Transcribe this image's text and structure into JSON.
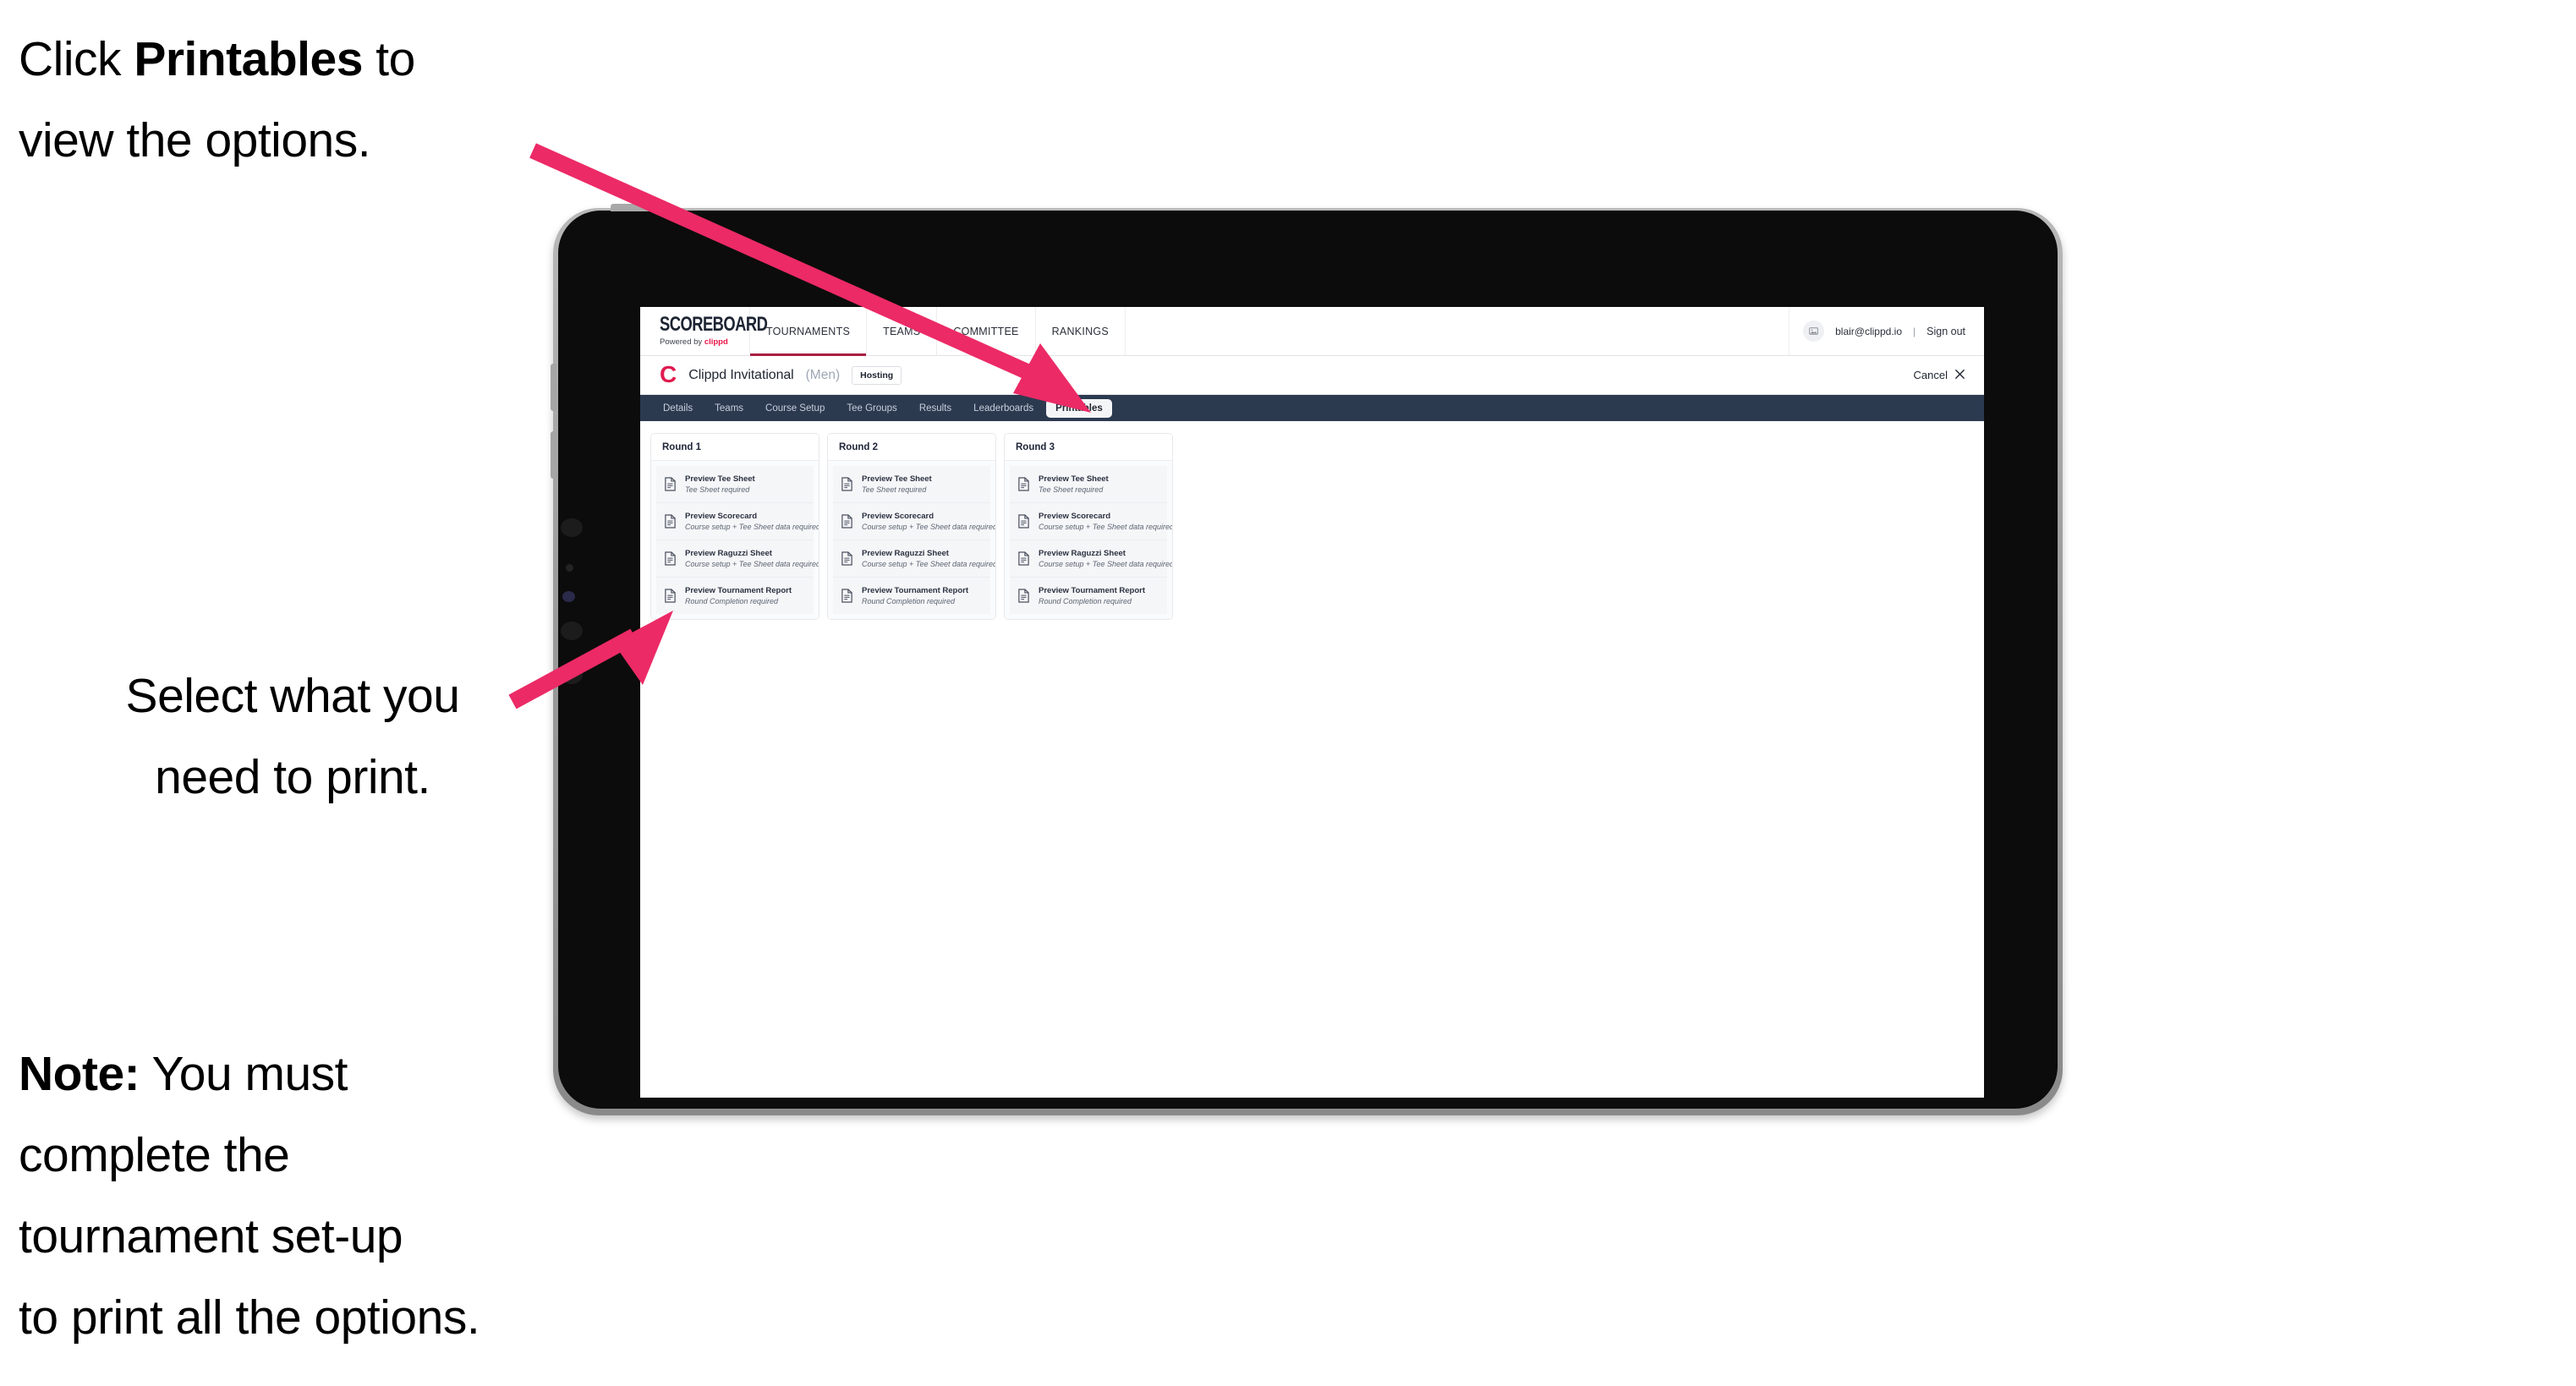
{
  "annotations": {
    "click_line1_pre": "Click ",
    "click_bold": "Printables",
    "click_line1_post": " to",
    "click_line2": "view the options.",
    "select_line1": "Select what you",
    "select_line2": "need to print.",
    "note_bold": "Note:",
    "note_line1_post": " You must",
    "note_line2": "complete the",
    "note_line3": "tournament set-up",
    "note_line4": "to print all the options."
  },
  "colors": {
    "arrow_pink": "#ec2a66",
    "tabbar_navy": "#2c3a50",
    "brand_red": "#e8174a",
    "clippd_red": "#e01a4f",
    "active_underline": "#a81f41"
  },
  "app": {
    "brand": {
      "title": "SCOREBOARD",
      "powered_prefix": "Powered by ",
      "powered_brand": "clippd"
    },
    "topnav": [
      {
        "label": "TOURNAMENTS",
        "active": true
      },
      {
        "label": "TEAMS",
        "active": false
      },
      {
        "label": "COMMITTEE",
        "active": false
      },
      {
        "label": "RANKINGS",
        "active": false
      }
    ],
    "account": {
      "avatar_icon": "user-image-icon",
      "email": "blair@clippd.io",
      "separator": "|",
      "sign_out": "Sign out"
    },
    "title_row": {
      "logo_letter": "C",
      "tournament_name": "Clippd Invitational",
      "gender": "(Men)",
      "badge": "Hosting",
      "cancel_label": "Cancel",
      "cancel_icon": "close-x-icon"
    },
    "tabs": [
      {
        "label": "Details",
        "active": false
      },
      {
        "label": "Teams",
        "active": false
      },
      {
        "label": "Course Setup",
        "active": false
      },
      {
        "label": "Tee Groups",
        "active": false
      },
      {
        "label": "Results",
        "active": false
      },
      {
        "label": "Leaderboards",
        "active": false
      },
      {
        "label": "Printables",
        "active": true
      }
    ],
    "rounds": [
      {
        "header": "Round 1",
        "items": [
          {
            "icon": "document-icon",
            "title": "Preview Tee Sheet",
            "subtitle": "Tee Sheet required"
          },
          {
            "icon": "document-icon",
            "title": "Preview Scorecard",
            "subtitle": "Course setup + Tee Sheet data required"
          },
          {
            "icon": "document-icon",
            "title": "Preview Raguzzi Sheet",
            "subtitle": "Course setup + Tee Sheet data required"
          },
          {
            "icon": "document-icon",
            "title": "Preview Tournament Report",
            "subtitle": "Round Completion required"
          }
        ]
      },
      {
        "header": "Round 2",
        "items": [
          {
            "icon": "document-icon",
            "title": "Preview Tee Sheet",
            "subtitle": "Tee Sheet required"
          },
          {
            "icon": "document-icon",
            "title": "Preview Scorecard",
            "subtitle": "Course setup + Tee Sheet data required"
          },
          {
            "icon": "document-icon",
            "title": "Preview Raguzzi Sheet",
            "subtitle": "Course setup + Tee Sheet data required"
          },
          {
            "icon": "document-icon",
            "title": "Preview Tournament Report",
            "subtitle": "Round Completion required"
          }
        ]
      },
      {
        "header": "Round 3",
        "items": [
          {
            "icon": "document-icon",
            "title": "Preview Tee Sheet",
            "subtitle": "Tee Sheet required"
          },
          {
            "icon": "document-icon",
            "title": "Preview Scorecard",
            "subtitle": "Course setup + Tee Sheet data required"
          },
          {
            "icon": "document-icon",
            "title": "Preview Raguzzi Sheet",
            "subtitle": "Course setup + Tee Sheet data required"
          },
          {
            "icon": "document-icon",
            "title": "Preview Tournament Report",
            "subtitle": "Round Completion required"
          }
        ]
      }
    ]
  }
}
